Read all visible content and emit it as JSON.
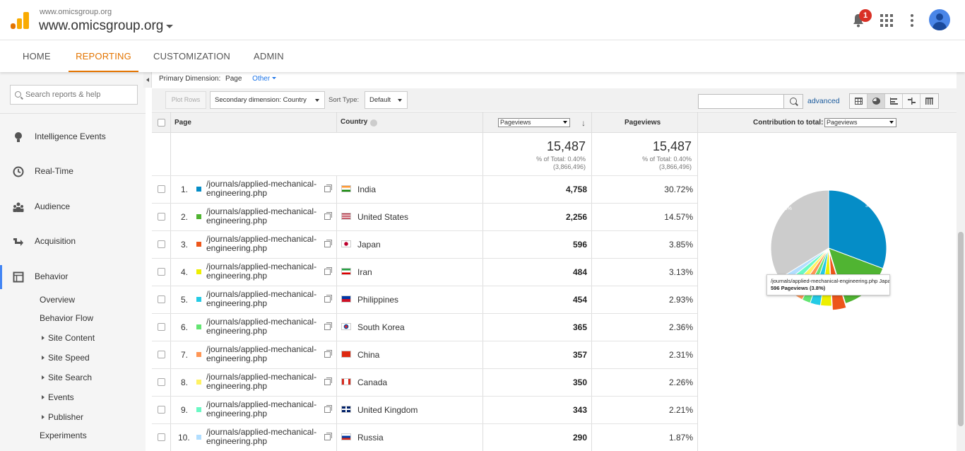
{
  "header": {
    "site_small": "www.omicsgroup.org",
    "site_big": "www.omicsgroup.org",
    "notifications": "1"
  },
  "nav": {
    "tabs": [
      "HOME",
      "REPORTING",
      "CUSTOMIZATION",
      "ADMIN"
    ],
    "active": "REPORTING"
  },
  "sidebar": {
    "search_placeholder": "Search reports & help",
    "items": [
      "Intelligence Events",
      "Real-Time",
      "Audience",
      "Acquisition",
      "Behavior"
    ],
    "sub_items": [
      "Overview",
      "Behavior Flow",
      "Site Content",
      "Site Speed",
      "Site Search",
      "Events",
      "Publisher",
      "Experiments"
    ]
  },
  "report": {
    "primary_label": "Primary Dimension:",
    "primary_value": "Page",
    "primary_other": "Other",
    "plot_rows": "Plot Rows",
    "secondary": "Secondary dimension: Country",
    "sort_label": "Sort Type:",
    "sort_value": "Default",
    "advanced": "advanced",
    "col_page": "Page",
    "col_country": "Country",
    "col_metric_select": "Pageviews",
    "col_pageviews": "Pageviews",
    "col_contribution": "Contribution to total:",
    "col_contribution_select": "Pageviews",
    "total_value": "15,487",
    "total_pct": "% of Total: 0.40%",
    "total_abs": "(3,866,496)",
    "total2_value": "15,487",
    "total2_pct": "% of Total: 0.40%",
    "total2_abs": "(3,866,496)",
    "rows": [
      {
        "idx": "1.",
        "page": "/journals/applied-mechanical-engineering.php",
        "country": "India",
        "pv": "4,758",
        "pct": "30.72%",
        "color": "#058dc7"
      },
      {
        "idx": "2.",
        "page": "/journals/applied-mechanical-engineering.php",
        "country": "United States",
        "pv": "2,256",
        "pct": "14.57%",
        "color": "#50b432"
      },
      {
        "idx": "3.",
        "page": "/journals/applied-mechanical-engineering.php",
        "country": "Japan",
        "pv": "596",
        "pct": "3.85%",
        "color": "#ed561b"
      },
      {
        "idx": "4.",
        "page": "/journals/applied-mechanical-engineering.php",
        "country": "Iran",
        "pv": "484",
        "pct": "3.13%",
        "color": "#edef00"
      },
      {
        "idx": "5.",
        "page": "/journals/applied-mechanical-engineering.php",
        "country": "Philippines",
        "pv": "454",
        "pct": "2.93%",
        "color": "#24cbe5"
      },
      {
        "idx": "6.",
        "page": "/journals/applied-mechanical-engineering.php",
        "country": "South Korea",
        "pv": "365",
        "pct": "2.36%",
        "color": "#64e572"
      },
      {
        "idx": "7.",
        "page": "/journals/applied-mechanical-engineering.php",
        "country": "China",
        "pv": "357",
        "pct": "2.31%",
        "color": "#ff9655"
      },
      {
        "idx": "8.",
        "page": "/journals/applied-mechanical-engineering.php",
        "country": "Canada",
        "pv": "350",
        "pct": "2.26%",
        "color": "#fff263"
      },
      {
        "idx": "9.",
        "page": "/journals/applied-mechanical-engineering.php",
        "country": "United Kingdom",
        "pv": "343",
        "pct": "2.21%",
        "color": "#6af9c4"
      },
      {
        "idx": "10.",
        "page": "/journals/applied-mechanical-engineering.php",
        "country": "Russia",
        "pv": "290",
        "pct": "1.87%",
        "color": "#b2deff"
      }
    ]
  },
  "pie": {
    "label_main": "30.7%",
    "label_other": "33.8%",
    "tooltip_line1": "/journals/applied-mechanical-engineering.php Japan",
    "tooltip_line2": "596 Pageviews (3.8%)",
    "other_color": "#cccccc",
    "slices": [
      30.72,
      14.57,
      3.85,
      3.13,
      2.93,
      2.36,
      2.31,
      2.26,
      2.21,
      1.87,
      33.79
    ]
  }
}
